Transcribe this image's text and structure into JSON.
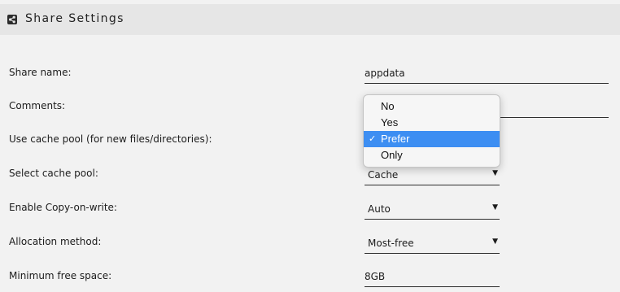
{
  "header": {
    "title": "Share Settings",
    "icon": "share-icon"
  },
  "fields": {
    "share_name": {
      "label": "Share name:",
      "value": "appdata"
    },
    "comments": {
      "label": "Comments:",
      "value": ""
    },
    "use_cache": {
      "label": "Use cache pool (for new files/directories):"
    },
    "cache_pool": {
      "label": "Select cache pool:",
      "value": "Cache"
    },
    "cow": {
      "label": "Enable Copy-on-write:",
      "value": "Auto"
    },
    "allocation": {
      "label": "Allocation method:",
      "value": "Most-free"
    },
    "min_free": {
      "label": "Minimum free space:",
      "value": "8GB"
    }
  },
  "dropdown": {
    "options": [
      "No",
      "Yes",
      "Prefer",
      "Only"
    ],
    "selected": "Prefer",
    "check": "✓"
  },
  "colors": {
    "selection": "#3d8ef2",
    "background": "#f2f2f2",
    "header": "#e6e6e6"
  }
}
